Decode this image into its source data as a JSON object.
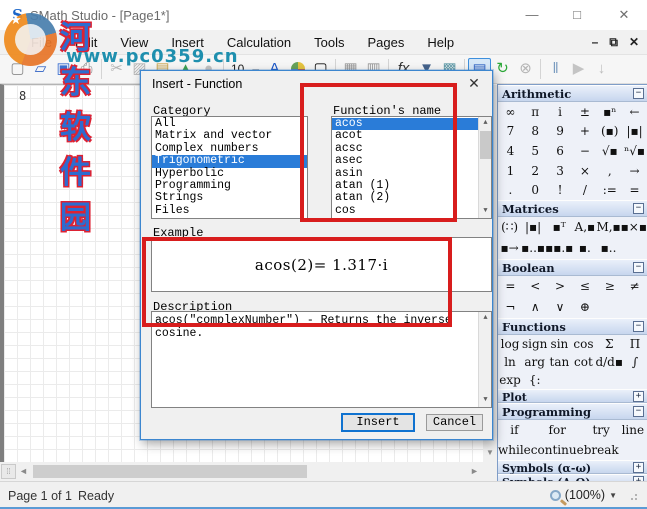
{
  "window": {
    "title": "SMath Studio - [Page1*]"
  },
  "watermark": {
    "line1": "河东软件园",
    "line2": "www.pc0359.cn"
  },
  "menu": {
    "items": [
      "File",
      "Edit",
      "View",
      "Insert",
      "Calculation",
      "Tools",
      "Pages",
      "Help"
    ]
  },
  "toolbar": {
    "items": [
      {
        "type": "icon",
        "name": "new-icon",
        "glyph": "▢",
        "color": "#8c8c8c"
      },
      {
        "type": "icon",
        "name": "open-icon",
        "glyph": "▱",
        "color": "#2f62c4"
      },
      {
        "type": "icon",
        "name": "save-icon",
        "glyph": "▣",
        "color": "#3a6fd0"
      },
      {
        "type": "icon",
        "name": "print-icon",
        "glyph": "⎙",
        "color": "#8a8a8a"
      },
      {
        "type": "sep"
      },
      {
        "type": "icon",
        "name": "cut-icon",
        "glyph": "✂",
        "color": "#b5b5b5"
      },
      {
        "type": "icon",
        "name": "copy-icon",
        "glyph": "▨",
        "color": "#b5b5b5"
      },
      {
        "type": "icon",
        "name": "paste-icon",
        "glyph": "▤",
        "color": "#c9a34a"
      },
      {
        "type": "icon",
        "name": "undo-icon",
        "glyph": "▲",
        "color": "#3ba153"
      },
      {
        "type": "icon",
        "name": "redo-icon",
        "glyph": "●",
        "color": "#c2c2c2"
      },
      {
        "type": "sep"
      },
      {
        "type": "text",
        "name": "font-size-value",
        "label": "10"
      },
      {
        "type": "text",
        "name": "font-smaller",
        "label": "–"
      },
      {
        "type": "icon",
        "name": "font-color-icon",
        "glyph": "A",
        "color": "#1a56c8"
      },
      {
        "type": "palette",
        "name": "background-color-icon"
      },
      {
        "type": "icon",
        "name": "border-icon",
        "glyph": "▢",
        "color": "#111"
      },
      {
        "type": "sep"
      },
      {
        "type": "icon",
        "name": "grid-small-icon",
        "glyph": "▦",
        "color": "#9a9a9a"
      },
      {
        "type": "icon",
        "name": "grid-large-icon",
        "glyph": "▥",
        "color": "#9a9a9a"
      },
      {
        "type": "sep"
      },
      {
        "type": "icon",
        "name": "function-fx-icon",
        "glyph": "fx",
        "color": "#333"
      },
      {
        "type": "icon",
        "name": "filter-icon",
        "glyph": "▼",
        "color": "#45638c"
      },
      {
        "type": "icon",
        "name": "picture-icon",
        "glyph": "▩",
        "color": "#5f9aa8"
      },
      {
        "type": "sep"
      },
      {
        "type": "icon",
        "name": "show-panels-icon",
        "glyph": "▤",
        "color": "#2f62c4",
        "pressed": true
      },
      {
        "type": "spacer"
      },
      {
        "type": "icon",
        "name": "recalculate-icon",
        "glyph": "↻",
        "color": "#2ca838"
      },
      {
        "type": "icon",
        "name": "stop-icon",
        "glyph": "⊗",
        "color": "#b5b5b5"
      },
      {
        "type": "sep"
      },
      {
        "type": "icon",
        "name": "pause-icon",
        "glyph": "‖",
        "color": "#7b9cc0"
      },
      {
        "type": "icon",
        "name": "play-icon",
        "glyph": "▶",
        "color": "#c4c4c4"
      },
      {
        "type": "icon",
        "name": "step-icon",
        "glyph": "↓",
        "color": "#bdbdbd"
      },
      {
        "type": "end-gap"
      }
    ]
  },
  "canvas": {
    "corner_label": "8"
  },
  "dialog": {
    "title": "Insert - Function",
    "close_glyph": "✕",
    "category_label": "Category",
    "function_label": "Function's name",
    "categories": [
      "All",
      "Matrix and vector",
      "Complex numbers",
      "Trigonometric",
      "Hyperbolic",
      "Programming",
      "Strings",
      "Files"
    ],
    "selected_category": "Trigonometric",
    "functions": [
      "acos",
      "acot",
      "acsc",
      "asec",
      "asin",
      "atan (1)",
      "atan (2)",
      "cos"
    ],
    "selected_function": "acos",
    "example_label": "Example",
    "example": "acos(2)= 1.317·i",
    "description_label": "Description",
    "description": "acos(\"complexNumber\") - Returns the inverse cosine.",
    "insert_label": "Insert",
    "cancel_label": "Cancel"
  },
  "panels": [
    {
      "title": "Arithmetic",
      "collapsed": false,
      "cols": 6,
      "buttons": [
        [
          "∞",
          "π",
          "i",
          "±",
          "▪ⁿ",
          "←"
        ],
        [
          "7",
          "8",
          "9",
          "+",
          "(▪)",
          "|▪|"
        ],
        [
          "4",
          "5",
          "6",
          "−",
          "√▪",
          "ⁿ√▪"
        ],
        [
          "1",
          "2",
          "3",
          "×",
          ",",
          "→"
        ],
        [
          ".",
          "0",
          "!",
          "/",
          ":=",
          "="
        ]
      ]
    },
    {
      "title": "Matrices",
      "collapsed": false,
      "cols": 6,
      "buttons": [
        [
          "(∷)",
          "|▪|",
          "▪ᵀ",
          "A,▪",
          "M,▪",
          "▪×▪"
        ],
        [
          "▪→",
          "▪..▪",
          "▪▪.▪",
          "▪.",
          "▪..",
          ""
        ]
      ]
    },
    {
      "title": "Boolean",
      "collapsed": false,
      "cols": 6,
      "buttons": [
        [
          "=",
          "<",
          ">",
          "≤",
          "≥",
          "≠"
        ],
        [
          "¬",
          "∧",
          "∨",
          "⊕",
          "",
          ""
        ]
      ]
    },
    {
      "title": "Functions",
      "collapsed": false,
      "cols": 6,
      "buttons": [
        [
          "log",
          "sign",
          "sin",
          "cos",
          "Σ",
          "Π"
        ],
        [
          "ln",
          "arg",
          "tan",
          "cot",
          "d/d▪",
          "∫"
        ],
        [
          "exp",
          "{:",
          "",
          "",
          "",
          ""
        ]
      ]
    },
    {
      "title": "Plot",
      "collapsed": true
    },
    {
      "title": "Programming",
      "collapsed": false,
      "cols": 4,
      "buttons": [
        [
          "if",
          "for",
          "try",
          "line"
        ],
        [
          "while",
          "continue",
          "break",
          ""
        ]
      ]
    },
    {
      "title": "Symbols (α-ω)",
      "collapsed": true
    },
    {
      "title": "Symbols (Α-Ω)",
      "collapsed": true
    }
  ],
  "statusbar": {
    "page": "Page 1 of 1",
    "ready": "Ready",
    "zoom": "(100%)"
  }
}
